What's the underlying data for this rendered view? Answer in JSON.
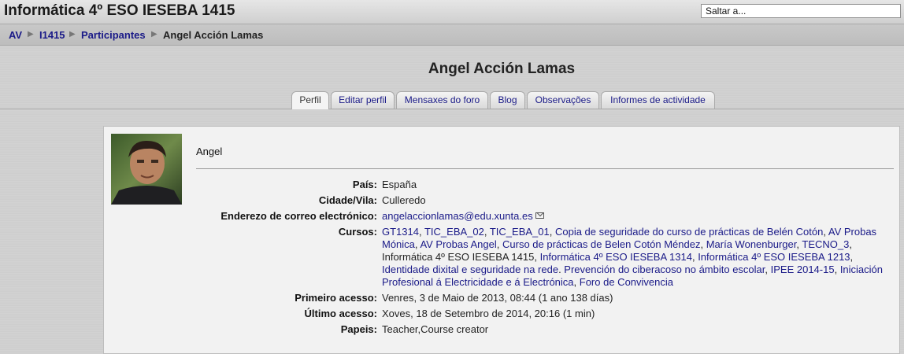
{
  "header": {
    "site_title": "Informática 4º ESO IESEBA 1415",
    "jump_placeholder": "Saltar a..."
  },
  "breadcrumb": {
    "items": [
      "AV",
      "I1415",
      "Participantes",
      "Angel Acción Lamas"
    ]
  },
  "page_title": "Angel Acción Lamas",
  "tabs": [
    "Perfil",
    "Editar perfil",
    "Mensaxes do foro",
    "Blog",
    "Observações",
    "Informes de actividade"
  ],
  "profile": {
    "name": "Angel",
    "country_label": "País:",
    "country": "España",
    "city_label": "Cidade/Vila:",
    "city": "Culleredo",
    "email_label": "Enderezo de correo electrónico:",
    "email": "angelaccionlamas@edu.xunta.es",
    "courses_label": "Cursos:",
    "courses": [
      "GT1314",
      "TIC_EBA_02",
      "TIC_EBA_01",
      "Copia de seguridade do curso de prácticas de Belén Cotón",
      "AV Probas Mónica",
      "AV Probas Angel",
      "Curso de prácticas de Belen Cotón Méndez",
      "María Wonenburger",
      "TECNO_3",
      "Informática 4º ESO IESEBA 1415",
      "Informática 4º ESO IESEBA 1314",
      "Informática 4º ESO IESEBA 1213",
      "Identidade dixital e seguridade na rede",
      "Prevención do ciberacoso no ámbito escolar",
      "IPEE 2014-15",
      "Iniciación Profesional á Electricidade e á Electrónica",
      "Foro de Convivencia"
    ],
    "first_access_label": "Primeiro acesso:",
    "first_access": "Venres, 3 de Maio de 2013, 08:44  (1 ano 138 días)",
    "last_access_label": "Último acesso:",
    "last_access": "Xoves, 18 de Setembro de 2014, 20:16  (1 min)",
    "roles_label": "Papeis:",
    "roles": "Teacher,Course creator"
  },
  "icons": {
    "email": "mail-icon",
    "avatar": "user-photo"
  }
}
